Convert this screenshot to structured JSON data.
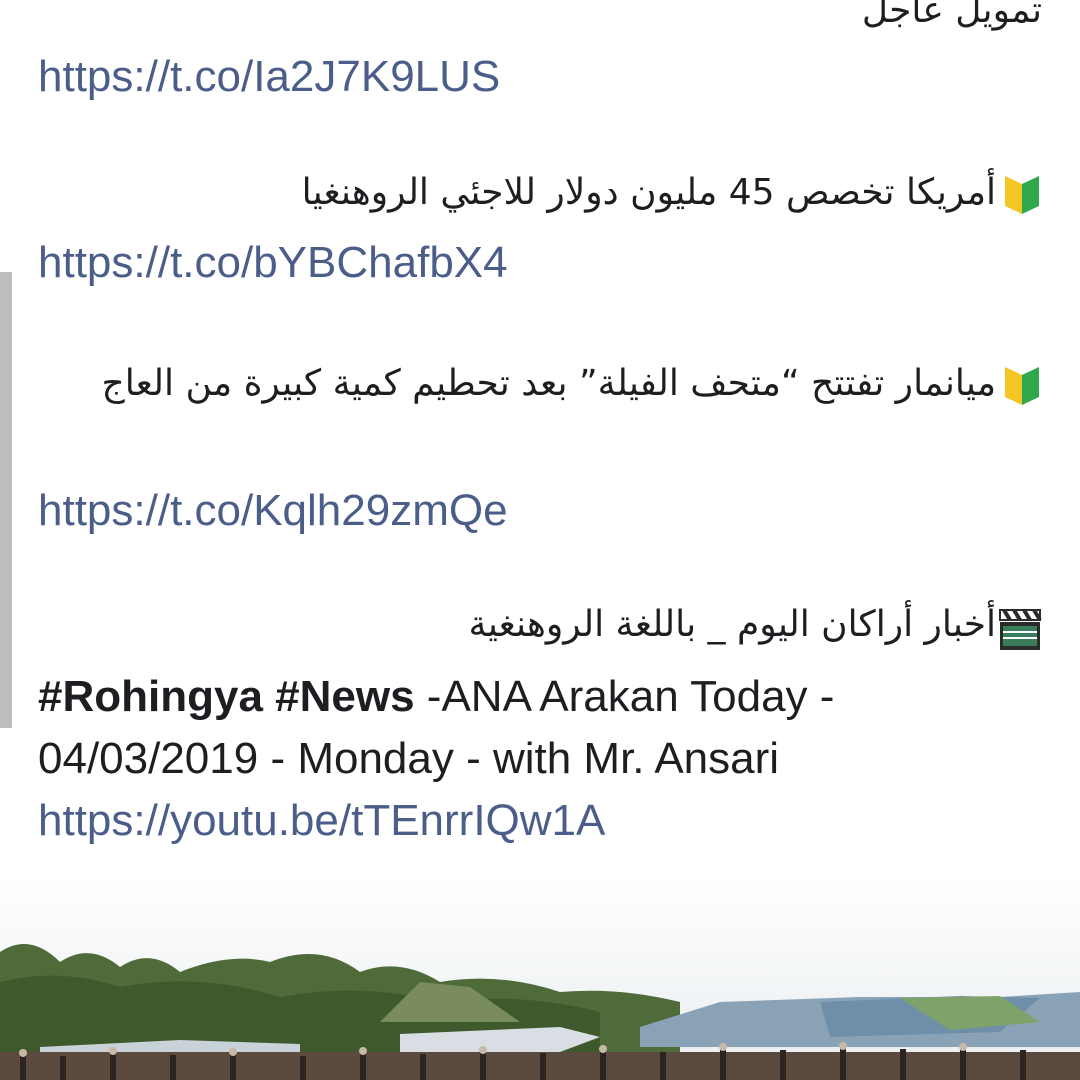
{
  "post": {
    "line0": "تمويل عاجل",
    "link1": "https://t.co/Ia2J7K9LUS",
    "item1_text": "أمريكا تخصص 45 مليون دولار للاجئي الروهنغيا",
    "link2": "https://t.co/bYBChafbX4",
    "item2_text": "ميانمار تفتتح “متحف الفيلة” بعد تحطيم كمية كبيرة من العاج",
    "link3": "https://t.co/Kqlh29zmQe",
    "item3_text": "أخبار أراكان اليوم _ باللغة الروهنغية",
    "hashtag1": "#Rohingya",
    "hashtag2": "#News",
    "en_line1_rest": " -ANA Arakan Today -",
    "en_line2": "04/03/2019 - Monday - with Mr. Ansari",
    "link4": "https://youtu.be/tTEnrrIQw1A"
  },
  "icons": {
    "item1": "beginner-badge-icon",
    "item2": "beginner-badge-icon",
    "item3": "clapper-board-icon"
  },
  "colors": {
    "link": "#4b5e8a",
    "text": "#1c1e21",
    "badge_yellow": "#f3c623",
    "badge_green": "#2ea84a"
  }
}
